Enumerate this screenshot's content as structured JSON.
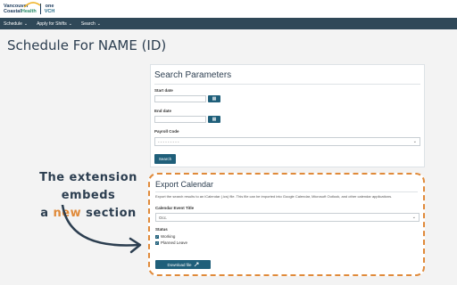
{
  "header": {
    "logo_line1": "Vancouver",
    "logo_line2a": "Coastal",
    "logo_line2b": "Health",
    "logo_one": "one",
    "logo_ych": "VCH"
  },
  "nav": {
    "items": [
      {
        "label": "Schedule"
      },
      {
        "label": "Apply for Shifts"
      },
      {
        "label": "Search"
      }
    ],
    "chevron": "⌄"
  },
  "page": {
    "title": "Schedule For NAME (ID)"
  },
  "search": {
    "title": "Search Parameters",
    "start_label": "Start date",
    "end_label": "End date",
    "payroll_label": "Payroll Code",
    "payroll_value": "- - - - - - - - -",
    "search_button": "Search",
    "calendar_icon": "▦",
    "caret": "⌄"
  },
  "export": {
    "title": "Export Calendar",
    "description": "Export the search results to an iCalendar (.ics) file. This file can be imported into Google Calendar, Microsoft Outlook, and other calendar applications.",
    "event_title_label": "Calendar Event Title",
    "event_title_value": "Occ.",
    "status_label": "Status",
    "status_options": [
      {
        "label": "Working",
        "checked": true
      },
      {
        "label": "Planned Leave",
        "checked": true
      }
    ],
    "download_button": "Download file"
  },
  "annotation": {
    "line1": "The extension embeds",
    "line2a": "a ",
    "line2b": "new",
    "line2c": " section"
  },
  "colors": {
    "accent": "#e08a3a",
    "primary": "#1f5f7a",
    "navbar": "#2f4858"
  }
}
